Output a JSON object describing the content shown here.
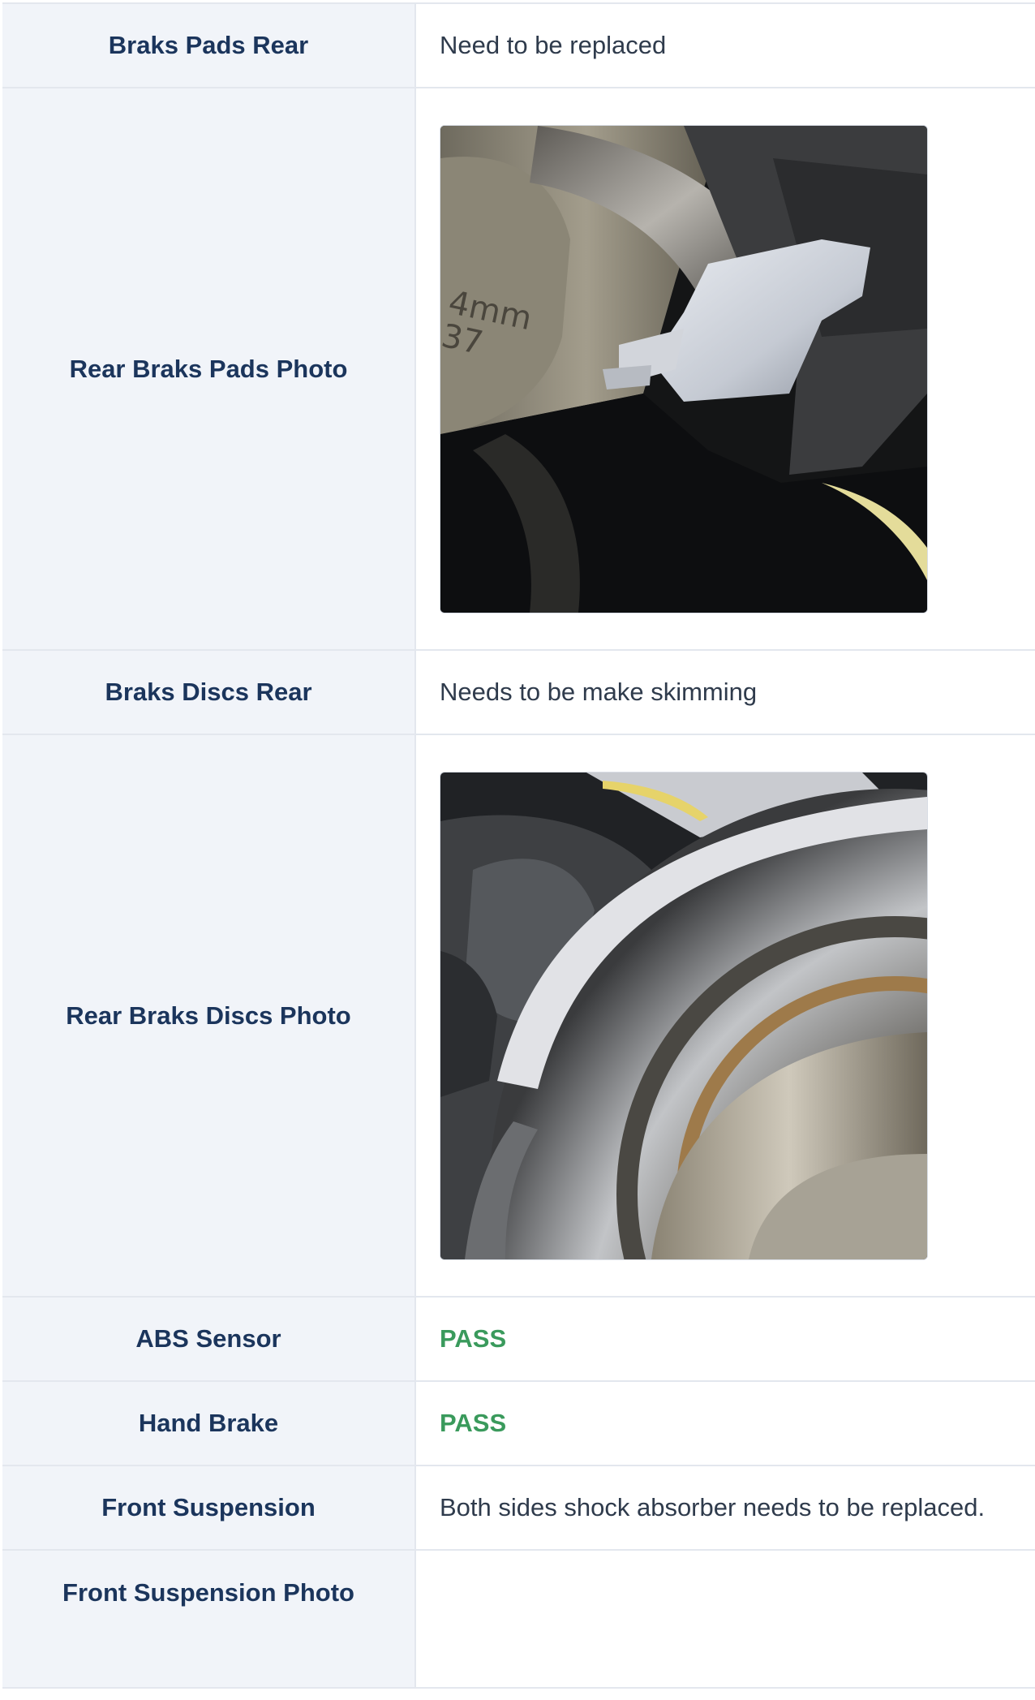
{
  "rows": [
    {
      "label": "Braks Pads Rear",
      "value": "Need to be replaced"
    },
    {
      "label": "Rear Braks Pads Photo",
      "photo": "rear-brake-pads-photo"
    },
    {
      "label": "Braks Discs Rear",
      "value": "Needs to be make skimming"
    },
    {
      "label": "Rear Braks Discs Photo",
      "photo": "rear-brake-discs-photo"
    },
    {
      "label": "ABS Sensor",
      "value": "PASS",
      "status_color": "#3a9a5c"
    },
    {
      "label": "Hand Brake",
      "value": "PASS",
      "status_color": "#3a9a5c"
    },
    {
      "label": "Front Suspension",
      "value": "Both sides shock absorber needs to be replaced."
    },
    {
      "label": "Front Suspension Photo",
      "value": ""
    }
  ],
  "photo_text": "4mm\n37",
  "colors": {
    "label_text": "#1b355c",
    "label_bg": "#f1f4f9",
    "border": "#e3e7ee",
    "value_text": "#2f3b4c",
    "pass": "#3a9a5c"
  }
}
